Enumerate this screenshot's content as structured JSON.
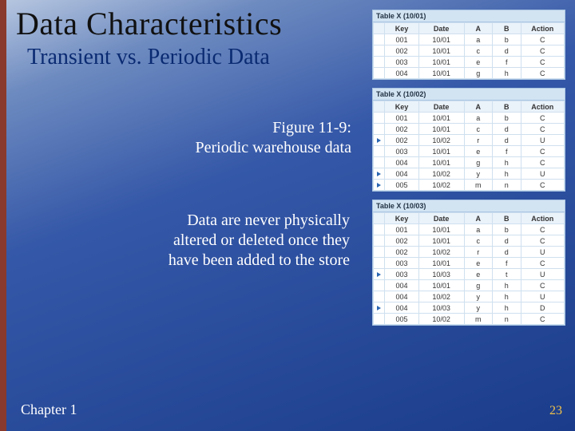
{
  "title": "Data Characteristics",
  "subtitle": "Transient vs. Periodic Data",
  "figure_label_line1": "Figure 11-9:",
  "figure_label_line2": "Periodic warehouse data",
  "body_line1": "Data are never physically",
  "body_line2": "altered or deleted once they",
  "body_line3": "have been added to the store",
  "chapter": "Chapter 1",
  "page_number": "23",
  "headers": {
    "key": "Key",
    "date": "Date",
    "a": "A",
    "b": "B",
    "action": "Action"
  },
  "tables": [
    {
      "caption": "Table X (10/01)",
      "rows": [
        {
          "mark": false,
          "key": "001",
          "date": "10/01",
          "a": "a",
          "b": "b",
          "action": "C"
        },
        {
          "mark": false,
          "key": "002",
          "date": "10/01",
          "a": "c",
          "b": "d",
          "action": "C"
        },
        {
          "mark": false,
          "key": "003",
          "date": "10/01",
          "a": "e",
          "b": "f",
          "action": "C"
        },
        {
          "mark": false,
          "key": "004",
          "date": "10/01",
          "a": "g",
          "b": "h",
          "action": "C"
        }
      ]
    },
    {
      "caption": "Table X (10/02)",
      "rows": [
        {
          "mark": false,
          "key": "001",
          "date": "10/01",
          "a": "a",
          "b": "b",
          "action": "C"
        },
        {
          "mark": false,
          "key": "002",
          "date": "10/01",
          "a": "c",
          "b": "d",
          "action": "C"
        },
        {
          "mark": true,
          "key": "002",
          "date": "10/02",
          "a": "r",
          "b": "d",
          "action": "U"
        },
        {
          "mark": false,
          "key": "003",
          "date": "10/01",
          "a": "e",
          "b": "f",
          "action": "C"
        },
        {
          "mark": false,
          "key": "004",
          "date": "10/01",
          "a": "g",
          "b": "h",
          "action": "C"
        },
        {
          "mark": true,
          "key": "004",
          "date": "10/02",
          "a": "y",
          "b": "h",
          "action": "U"
        },
        {
          "mark": true,
          "key": "005",
          "date": "10/02",
          "a": "m",
          "b": "n",
          "action": "C"
        }
      ]
    },
    {
      "caption": "Table X (10/03)",
      "rows": [
        {
          "mark": false,
          "key": "001",
          "date": "10/01",
          "a": "a",
          "b": "b",
          "action": "C"
        },
        {
          "mark": false,
          "key": "002",
          "date": "10/01",
          "a": "c",
          "b": "d",
          "action": "C"
        },
        {
          "mark": false,
          "key": "002",
          "date": "10/02",
          "a": "r",
          "b": "d",
          "action": "U"
        },
        {
          "mark": false,
          "key": "003",
          "date": "10/01",
          "a": "e",
          "b": "f",
          "action": "C"
        },
        {
          "mark": true,
          "key": "003",
          "date": "10/03",
          "a": "e",
          "b": "t",
          "action": "U"
        },
        {
          "mark": false,
          "key": "004",
          "date": "10/01",
          "a": "g",
          "b": "h",
          "action": "C"
        },
        {
          "mark": false,
          "key": "004",
          "date": "10/02",
          "a": "y",
          "b": "h",
          "action": "U"
        },
        {
          "mark": true,
          "key": "004",
          "date": "10/03",
          "a": "y",
          "b": "h",
          "action": "D"
        },
        {
          "mark": false,
          "key": "005",
          "date": "10/02",
          "a": "m",
          "b": "n",
          "action": "C"
        }
      ]
    }
  ]
}
